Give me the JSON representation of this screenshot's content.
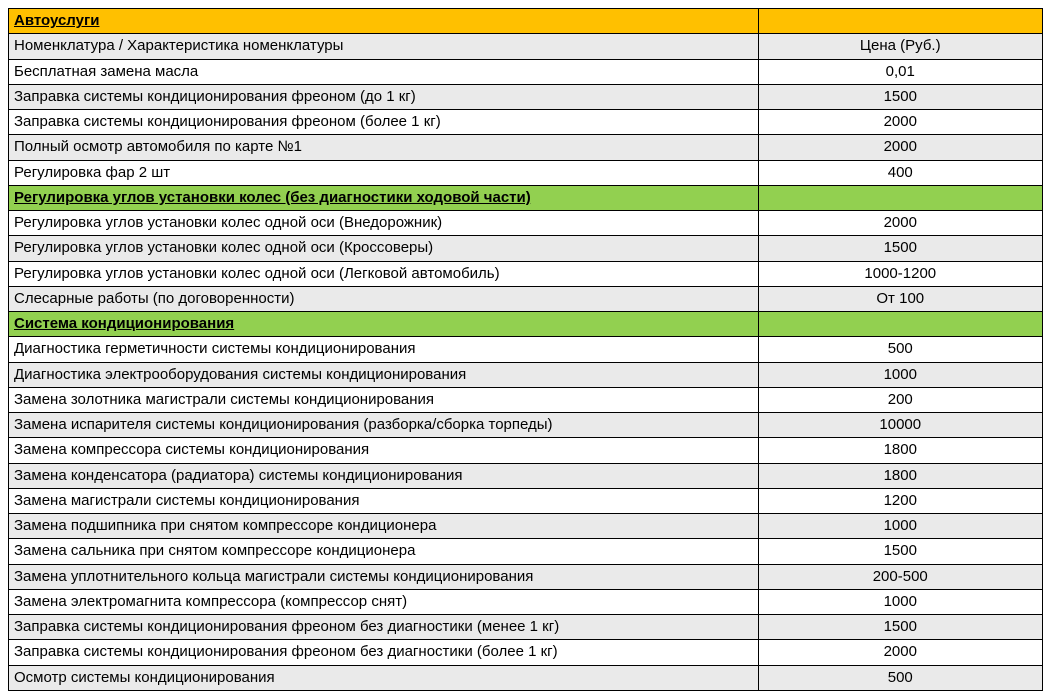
{
  "columns": {
    "name": "Номенклатура / Характеристика номенклатуры",
    "price": "Цена (Руб.)"
  },
  "sections": [
    {
      "title": "Автоуслуги",
      "headerClass": "hdr-orange",
      "showColumns": true,
      "rows": [
        {
          "name": "Бесплатная замена масла",
          "price": "0,01"
        },
        {
          "name": "Заправка системы кондиционирования фреоном (до 1 кг)",
          "price": "1500"
        },
        {
          "name": "Заправка системы кондиционирования фреоном (более 1 кг)",
          "price": "2000"
        },
        {
          "name": "Полный осмотр автомобиля по карте №1",
          "price": "2000"
        },
        {
          "name": "Регулировка фар 2 шт",
          "price": "400"
        }
      ]
    },
    {
      "title": "Регулировка углов установки колес (без диагностики ходовой части)",
      "headerClass": "hdr-green",
      "showColumns": false,
      "rows": [
        {
          "name": "Регулировка углов установки колес одной оси  (Внедорожник)",
          "price": "2000"
        },
        {
          "name": "Регулировка углов установки колес одной оси  (Кроссоверы)",
          "price": "1500"
        },
        {
          "name": "Регулировка углов установки колес одной оси (Легковой автомобиль)",
          "price": "1000-1200"
        },
        {
          "name": "Слесарные работы (по договоренности)",
          "price": "От 100"
        }
      ]
    },
    {
      "title": "Система кондиционирования",
      "headerClass": "hdr-green",
      "showColumns": false,
      "rows": [
        {
          "name": "Диагностика герметичности системы кондиционирования",
          "price": "500"
        },
        {
          "name": "Диагностика электрооборудования системы кондиционирования",
          "price": "1000"
        },
        {
          "name": "Замена золотника магистрали системы кондиционирования",
          "price": "200"
        },
        {
          "name": "Замена испарителя системы кондиционирования (разборка/сборка торпеды)",
          "price": "10000"
        },
        {
          "name": "Замена компрессора системы кондиционирования",
          "price": "1800"
        },
        {
          "name": "Замена конденсатора (радиатора) системы кондиционирования",
          "price": "1800"
        },
        {
          "name": "Замена магистрали системы кондиционирования",
          "price": "1200"
        },
        {
          "name": "Замена подшипника при снятом компрессоре кондиционера",
          "price": "1000"
        },
        {
          "name": "Замена сальника при снятом компрессоре кондиционера",
          "price": "1500"
        },
        {
          "name": "Замена уплотнительного кольца магистрали системы кондиционирования",
          "price": "200-500"
        },
        {
          "name": "Замена электромагнита компрессора (компрессор снят)",
          "price": "1000"
        },
        {
          "name": "Заправка системы кондиционирования фреоном без  диагностики (менее 1 кг)",
          "price": "1500"
        },
        {
          "name": "Заправка системы кондиционирования фреоном без  диагностики (более 1 кг)",
          "price": "2000"
        },
        {
          "name": "Осмотр системы кондиционирования",
          "price": "500"
        }
      ]
    }
  ]
}
